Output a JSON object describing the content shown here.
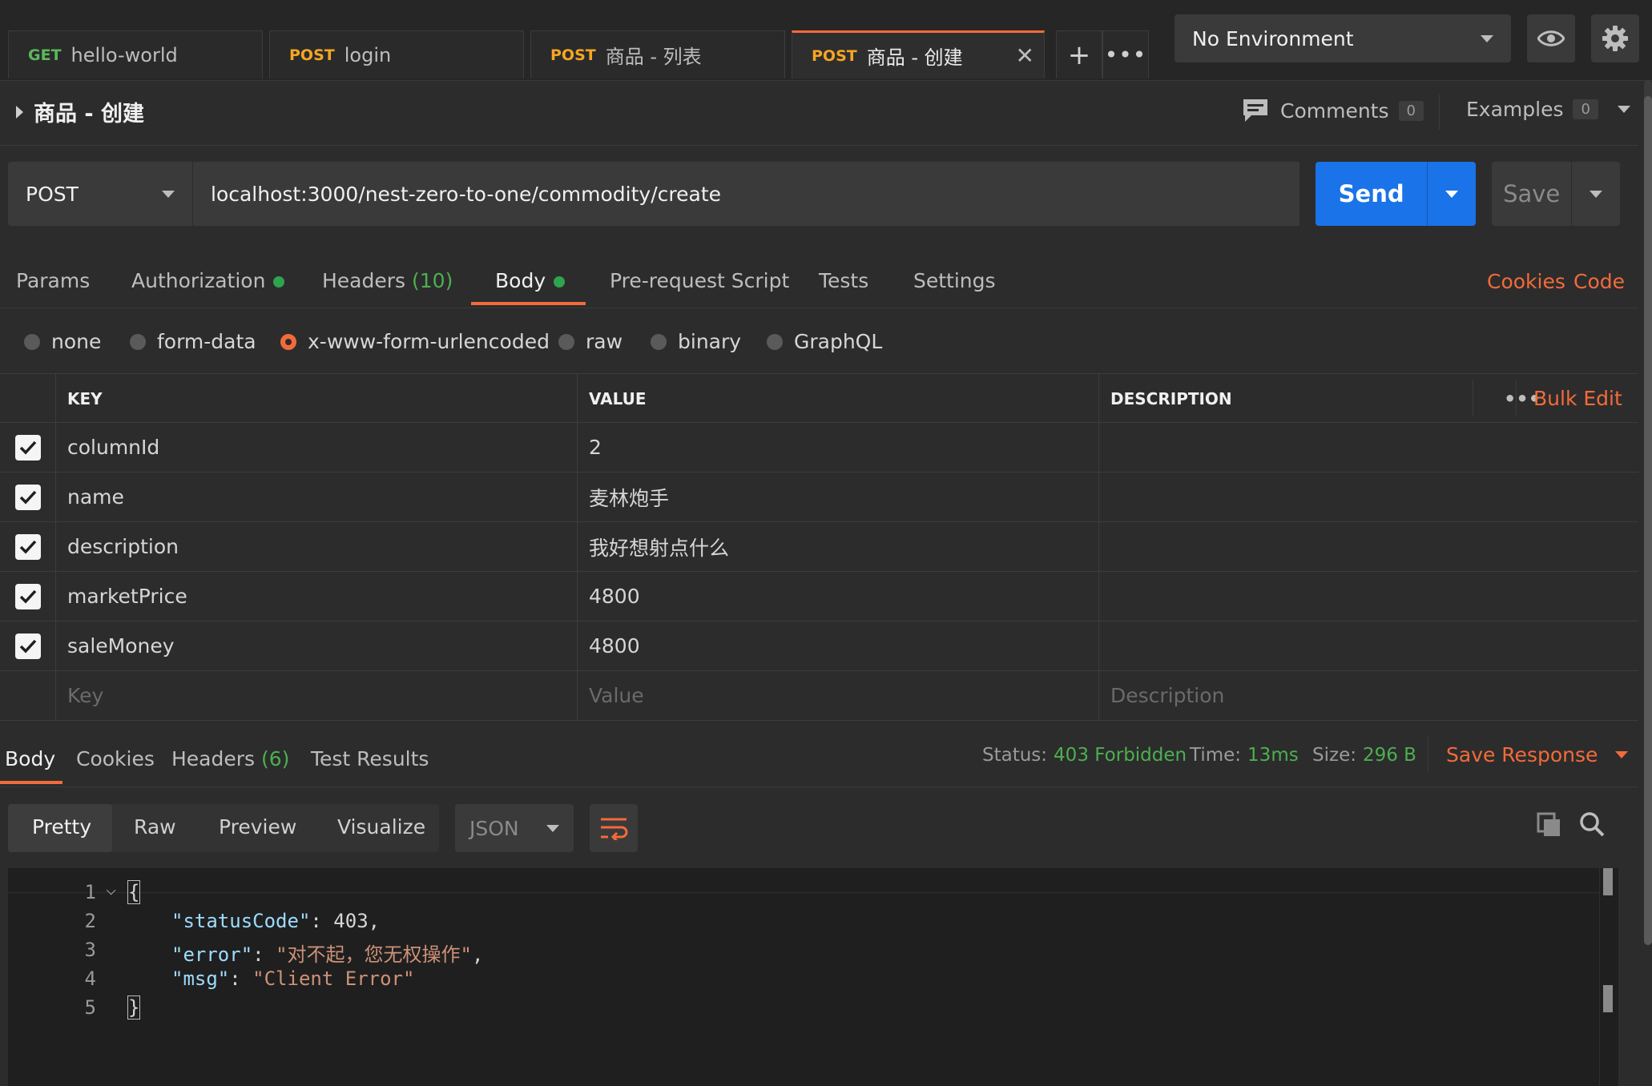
{
  "tabs": [
    {
      "method": "GET",
      "name": "hello-world"
    },
    {
      "method": "POST",
      "name": "login"
    },
    {
      "method": "POST",
      "name": "商品 - 列表"
    },
    {
      "method": "POST",
      "name": "商品 - 创建"
    }
  ],
  "environment": {
    "selected": "No Environment"
  },
  "request": {
    "title": "商品 - 创建",
    "comments_label": "Comments",
    "comments_count": "0",
    "examples_label": "Examples",
    "examples_count": "0",
    "method": "POST",
    "url": "localhost:3000/nest-zero-to-one/commodity/create",
    "send_label": "Send",
    "save_label": "Save"
  },
  "request_tabs": {
    "params": "Params",
    "authorization": "Authorization",
    "headers": "Headers",
    "headers_count": "(10)",
    "body": "Body",
    "prerequest": "Pre-request Script",
    "tests": "Tests",
    "settings": "Settings",
    "cookies": "Cookies",
    "code": "Code"
  },
  "body_types": [
    "none",
    "form-data",
    "x-www-form-urlencoded",
    "raw",
    "binary",
    "GraphQL"
  ],
  "body_type_selected": "x-www-form-urlencoded",
  "table": {
    "headers": {
      "key": "KEY",
      "value": "VALUE",
      "description": "DESCRIPTION",
      "bulk_edit": "Bulk Edit"
    },
    "rows": [
      {
        "key": "columnId",
        "value": "2"
      },
      {
        "key": "name",
        "value": "麦林炮手"
      },
      {
        "key": "description",
        "value": "我好想射点什么"
      },
      {
        "key": "marketPrice",
        "value": "4800"
      },
      {
        "key": "saleMoney",
        "value": "4800"
      }
    ],
    "placeholders": {
      "key": "Key",
      "value": "Value",
      "description": "Description"
    }
  },
  "response": {
    "tabs": {
      "body": "Body",
      "cookies": "Cookies",
      "headers": "Headers",
      "headers_count": "(6)",
      "test_results": "Test Results"
    },
    "status_label": "Status:",
    "status": "403 Forbidden",
    "time_label": "Time:",
    "time": "13ms",
    "size_label": "Size:",
    "size": "296 B",
    "save_response": "Save Response",
    "views": [
      "Pretty",
      "Raw",
      "Preview",
      "Visualize"
    ],
    "format": "JSON",
    "code_lines": [
      "1",
      "2",
      "3",
      "4",
      "5"
    ],
    "json": {
      "statusCode_key": "\"statusCode\"",
      "statusCode_val": "403",
      "error_key": "\"error\"",
      "error_val": "\"对不起，您无权操作\"",
      "msg_key": "\"msg\"",
      "msg_val": "\"Client Error\""
    }
  },
  "colors": {
    "accent": "#f26b3a",
    "send": "#1a73e8",
    "ok_green": "#4caf50"
  }
}
